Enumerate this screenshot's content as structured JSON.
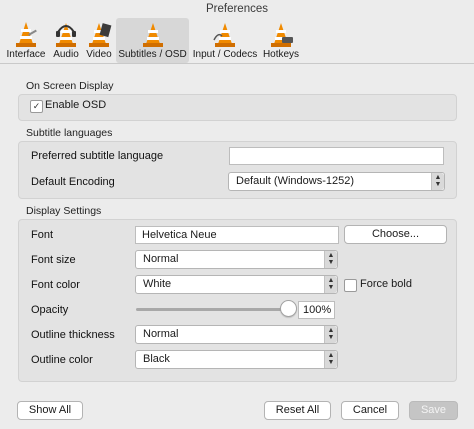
{
  "window": {
    "title": "Preferences"
  },
  "tabs": [
    {
      "label": "Interface",
      "icon": "cone-with-tools-icon",
      "active": false
    },
    {
      "label": "Audio",
      "icon": "cone-headphones-icon",
      "active": false
    },
    {
      "label": "Video",
      "icon": "cone-film-icon",
      "active": false
    },
    {
      "label": "Subtitles / OSD",
      "icon": "cone-subtitles-icon",
      "active": true
    },
    {
      "label": "Input / Codecs",
      "icon": "cone-cable-icon",
      "active": false
    },
    {
      "label": "Hotkeys",
      "icon": "cone-keyboard-icon",
      "active": false
    }
  ],
  "osd": {
    "section_title": "On Screen Display",
    "enable_label": "Enable OSD",
    "enable_checked": true
  },
  "subtitle_languages": {
    "section_title": "Subtitle languages",
    "preferred_label": "Preferred subtitle language",
    "preferred_value": "",
    "encoding_label": "Default Encoding",
    "encoding_value": "Default (Windows-1252)"
  },
  "display": {
    "section_title": "Display Settings",
    "font_label": "Font",
    "font_value": "Helvetica Neue",
    "choose_label": "Choose...",
    "font_size_label": "Font size",
    "font_size_value": "Normal",
    "font_color_label": "Font color",
    "font_color_value": "White",
    "force_bold_label": "Force bold",
    "force_bold_checked": false,
    "opacity_label": "Opacity",
    "opacity_value": "100%",
    "opacity_fraction": 1.0,
    "outline_thickness_label": "Outline thickness",
    "outline_thickness_value": "Normal",
    "outline_color_label": "Outline color",
    "outline_color_value": "Black"
  },
  "footer": {
    "show_all": "Show All",
    "reset_all": "Reset All",
    "cancel": "Cancel",
    "save": "Save"
  },
  "colors": {
    "accent": "#f08a00",
    "save_disabled_bg": "#c5c5c5"
  }
}
